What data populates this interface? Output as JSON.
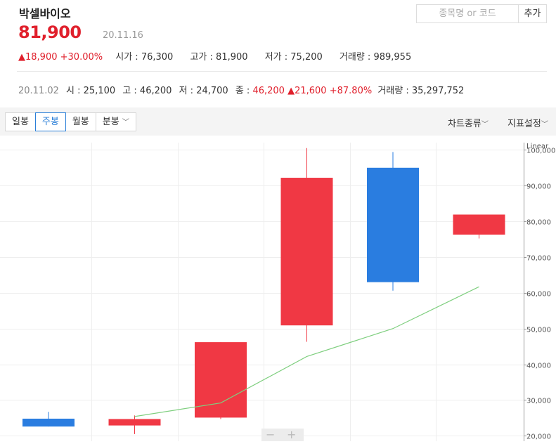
{
  "stock": {
    "name": "박셀바이오",
    "price": "81,900",
    "date": "20.11.16",
    "change_icon": "arrow-up-icon",
    "change_amount": "18,900",
    "change_pct": "+30.00%",
    "open_label": "시가",
    "open": "76,300",
    "high_label": "고가",
    "high": "81,900",
    "low_label": "저가",
    "low": "75,200",
    "volume_label": "거래량",
    "volume": "989,955"
  },
  "search": {
    "placeholder": "종목명 or 코드",
    "add_label": "추가"
  },
  "selected_bar": {
    "date": "20.11.02",
    "open_label": "시",
    "open": "25,100",
    "high_label": "고",
    "high": "46,200",
    "low_label": "저",
    "low": "24,700",
    "close_label": "종",
    "close": "46,200",
    "change": "21,600",
    "change_pct": "+87.80%",
    "volume_label": "거래량",
    "volume": "35,297,752"
  },
  "tabs": [
    "일봉",
    "주봉",
    "월봉",
    "분봉"
  ],
  "active_tab": "주봉",
  "right_menu": {
    "chart_type": "차트종류",
    "indicator": "지표설정"
  },
  "colors": {
    "up": "#f03844",
    "down": "#2a7de0",
    "ma": "#7fcf7f"
  },
  "chart_data": {
    "type": "candlestick",
    "scale_label": "Linear",
    "y_ticks": [
      20000,
      30000,
      40000,
      50000,
      60000,
      70000,
      80000,
      90000,
      100000
    ],
    "y_tick_labels": [
      "20,000",
      "30,000",
      "40,000",
      "50,000",
      "60,000",
      "70,000",
      "80,000",
      "90,000",
      "100,000"
    ],
    "ylim": [
      18500,
      104000
    ],
    "candles": [
      {
        "open": 24800,
        "close": 22600,
        "high": 26700,
        "low": 22600
      },
      {
        "open": 22900,
        "close": 24700,
        "high": 25700,
        "low": 20500
      },
      {
        "open": 25100,
        "close": 46200,
        "high": 46200,
        "low": 24700
      },
      {
        "open": 50900,
        "close": 92200,
        "high": 100500,
        "low": 46300
      },
      {
        "open": 95000,
        "close": 63000,
        "high": 99400,
        "low": 60600
      },
      {
        "open": 76300,
        "close": 81900,
        "high": 81900,
        "low": 75200
      }
    ],
    "moving_average": [
      null,
      25400,
      29200,
      42200,
      50000,
      61700
    ]
  }
}
